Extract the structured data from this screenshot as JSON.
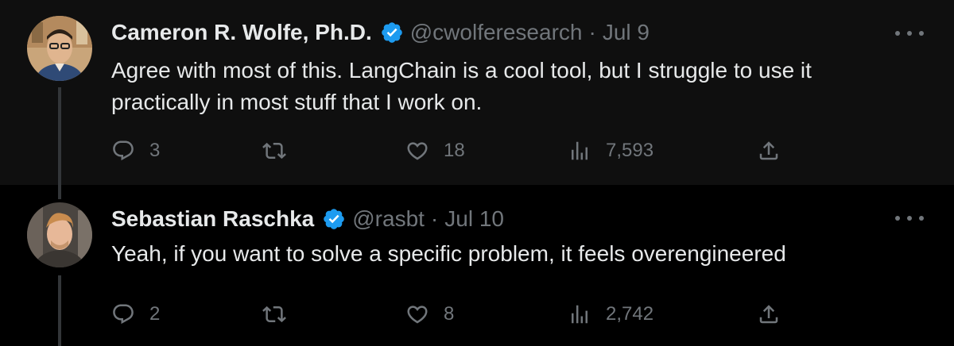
{
  "tweets": [
    {
      "author_name": "Cameron R. Wolfe, Ph.D.",
      "handle": "@cwolferesearch",
      "separator": "·",
      "date": "Jul 9",
      "text": "Agree with most of this. LangChain is a cool tool, but I struggle to use it practically in most stuff that I work on.",
      "replies": "3",
      "retweets": "",
      "likes": "18",
      "views": "7,593"
    },
    {
      "author_name": "Sebastian Raschka",
      "handle": "@rasbt",
      "separator": "·",
      "date": "Jul 10",
      "text": "Yeah, if you want to solve a specific problem, it feels overengineered",
      "replies": "2",
      "retweets": "",
      "likes": "8",
      "views": "2,742"
    }
  ],
  "colors": {
    "background": "#000000",
    "first_tweet_background": "#0f0f0f",
    "text": "#e7e9ea",
    "muted": "#71767b",
    "verified": "#1d9bf0",
    "thread_line": "#333639"
  },
  "icons": [
    "verified-badge-icon",
    "more-icon",
    "reply-icon",
    "retweet-icon",
    "like-icon",
    "views-icon",
    "share-icon"
  ]
}
